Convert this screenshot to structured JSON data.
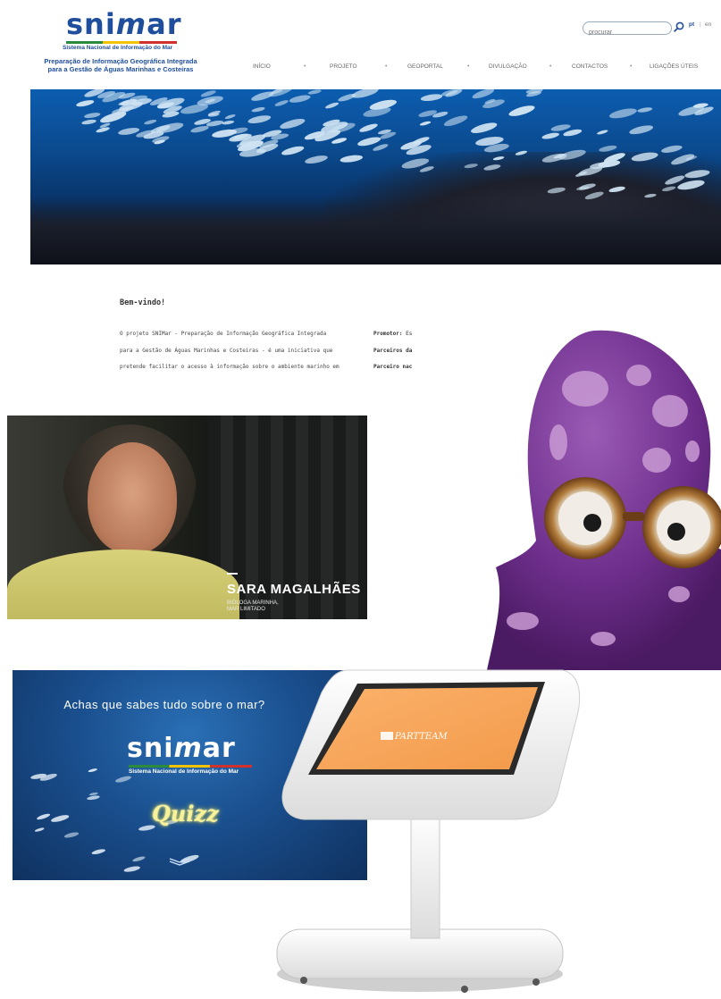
{
  "site": {
    "logo": {
      "word_left": "sni",
      "word_m": "m",
      "word_right": "ar",
      "subtitle": "Sistema Nacional de Informação do Mar"
    },
    "tagline": {
      "line1": "Preparação de Informação Geográfica Integrada",
      "line2": "para a Gestão de Águas Marinhas e Costeiras"
    },
    "search": {
      "placeholder": "procurar"
    },
    "languages": {
      "pt": "pt",
      "separator": "|",
      "en": "en"
    },
    "nav": [
      {
        "label": "INÍCIO"
      },
      {
        "label": "PROJETO"
      },
      {
        "label": "GEOPORTAL"
      },
      {
        "label": "DIVULGAÇÃO"
      },
      {
        "label": "CONTACTOS"
      },
      {
        "label": "LIGAÇÕES ÚTEIS"
      }
    ],
    "nav_separator": "•",
    "welcome": {
      "title": "Bem-vindo!",
      "lines": [
        "O projeto SNIMar - Preparação de Informação Geográfica Integrada",
        "para a Gestão de Águas Marinhas e Costeiras - é uma iniciativa que",
        "pretende facilitar o acesso à informação sobre o ambiente marinho em"
      ]
    },
    "sidebar": [
      {
        "label": "Promotor:",
        "value": "Es"
      },
      {
        "label": "Parceiros da",
        "value": ""
      },
      {
        "label": "Parceiro nac",
        "value": ""
      }
    ]
  },
  "video": {
    "name": "SARA MAGALHÃES",
    "role_line1": "BIÓLOGA MARINHA,",
    "role_line2": "MAR LIMITADO"
  },
  "quiz": {
    "question": "Achas que sabes tudo sobre o mar?",
    "logo": {
      "word_left": "sni",
      "word_m": "m",
      "word_right": "ar",
      "subtitle": "Sistema Nacional de Informação do Mar"
    },
    "title": "Quizz"
  },
  "kiosk": {
    "brand": "PARTTEAM"
  },
  "colors": {
    "brand_blue": "#1f4e9c",
    "quiz_glow": "#f7f19a",
    "kiosk_screen": "#f39a4b",
    "octopus": "#7b3a97"
  },
  "icons": {
    "search": "search-icon",
    "chevron": "chevron-down-icon"
  }
}
